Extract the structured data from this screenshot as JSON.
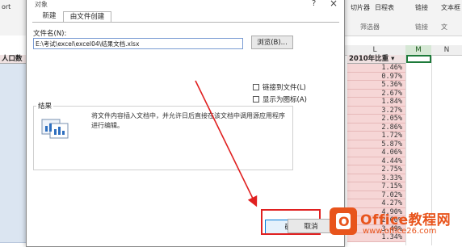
{
  "excel": {
    "ribbon": {
      "partial_left": "ort",
      "buttons": [
        "切片器",
        "日程表",
        "链接",
        "文本框"
      ],
      "group_filter": "筛选器",
      "group_link": "链接",
      "group_text": "文"
    },
    "columns": {
      "L": "L",
      "M": "M",
      "N": "N"
    },
    "left_header": "人口数",
    "col_header_label": "2010年比重",
    "values": [
      "1.46%",
      "0.97%",
      "5.36%",
      "2.67%",
      "1.84%",
      "3.27%",
      "2.05%",
      "2.86%",
      "1.72%",
      "5.87%",
      "4.06%",
      "4.44%",
      "2.75%",
      "3.33%",
      "7.15%",
      "7.02%",
      "4.27%",
      "4.90%",
      "2.60%",
      "3.49%",
      "1.34%"
    ]
  },
  "dialog": {
    "title": "对象",
    "help": "?",
    "close": "×",
    "tabs": {
      "new": "新建",
      "from_file": "由文件创建"
    },
    "file_name_label": "文件名(N):",
    "file_name_value": "E:\\考试\\excel\\excel04\\结果文档.xlsx",
    "browse_label": "浏览(B)...",
    "link_to_file_label": "链接到文件(L)",
    "show_as_icon_label": "显示为图标(A)",
    "result_label": "结果",
    "result_text": "将文件内容插入文档中，并允许日后直接在该文档中调用源应用程序进行编辑。",
    "ok_label": "确定",
    "cancel_label": "取消"
  },
  "watermark": {
    "brand": "Office教程网",
    "url": "www.office26.com"
  },
  "colors": {
    "annotation_red": "#e02020",
    "cell_pink": "#f6d6d6",
    "selection_green": "#1d7a3a",
    "watermark_orange": "#e8541c"
  }
}
